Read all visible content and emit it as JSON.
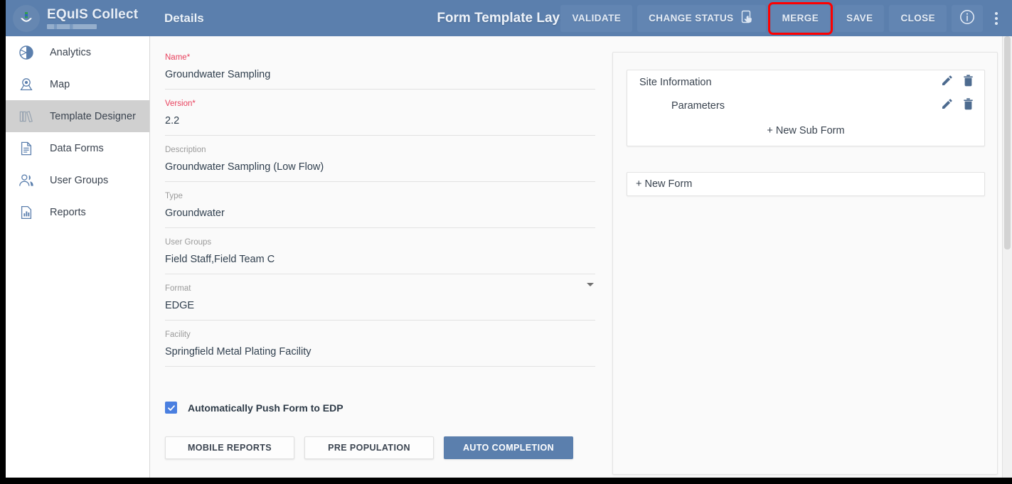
{
  "header": {
    "brand": "EQuIS Collect",
    "section": "Details",
    "title": "Form Template Layout",
    "logo_icon": "equis-anchor-logo-icon",
    "actions": [
      {
        "label": "VALIDATE",
        "name": "validate-button",
        "icon": null,
        "highlight": false
      },
      {
        "label": "CHANGE STATUS",
        "name": "change-status-button",
        "icon": "tap-device-icon",
        "highlight": false
      },
      {
        "label": "MERGE",
        "name": "merge-button",
        "icon": null,
        "highlight": true
      },
      {
        "label": "SAVE",
        "name": "save-button",
        "icon": null,
        "highlight": false
      },
      {
        "label": "CLOSE",
        "name": "close-button",
        "icon": null,
        "highlight": false
      }
    ],
    "info_icon": "info-circle-icon",
    "overflow_icon": "kebab-menu-icon",
    "highlight_color": "#ff0000",
    "bar_color": "#5b7fad"
  },
  "sidebar": {
    "items": [
      {
        "label": "Analytics",
        "icon": "pie-chart-icon",
        "active": false
      },
      {
        "label": "Map",
        "icon": "map-pin-icon",
        "active": false
      },
      {
        "label": "Template Designer",
        "icon": "books-icon",
        "active": true
      },
      {
        "label": "Data Forms",
        "icon": "document-icon",
        "active": false
      },
      {
        "label": "User Groups",
        "icon": "users-icon",
        "active": false
      },
      {
        "label": "Reports",
        "icon": "bar-chart-document-icon",
        "active": false
      }
    ]
  },
  "details_form": {
    "fields": [
      {
        "label": "Name",
        "required": true,
        "value": "Groundwater Sampling",
        "type": "text",
        "name": "name-field"
      },
      {
        "label": "Version",
        "required": true,
        "value": "2.2",
        "type": "text",
        "name": "version-field"
      },
      {
        "label": "Description",
        "required": false,
        "value": "Groundwater Sampling (Low Flow)",
        "type": "text",
        "name": "description-field"
      },
      {
        "label": "Type",
        "required": false,
        "value": "Groundwater",
        "type": "text",
        "name": "type-field"
      },
      {
        "label": "User Groups",
        "required": false,
        "value": "Field Staff,Field Team C",
        "type": "text",
        "name": "user-groups-field"
      },
      {
        "label": "Format",
        "required": false,
        "value": "EDGE",
        "type": "select",
        "name": "format-select"
      },
      {
        "label": "Facility",
        "required": false,
        "value": "Springfield Metal Plating Facility",
        "type": "text",
        "name": "facility-field"
      }
    ],
    "checkbox": {
      "label": "Automatically Push Form to EDP",
      "checked": true
    },
    "buttons": [
      {
        "label": "MOBILE REPORTS",
        "name": "mobile-reports-button",
        "primary": false
      },
      {
        "label": "PRE POPULATION",
        "name": "pre-population-button",
        "primary": false
      },
      {
        "label": "AUTO COMPLETION",
        "name": "auto-completion-button",
        "primary": true
      }
    ],
    "required_marker": "*"
  },
  "form_tree": {
    "forms": [
      {
        "name": "Site Information",
        "edit_icon": "pencil-icon",
        "delete_icon": "trash-icon",
        "subforms": [
          {
            "name": "Parameters",
            "edit_icon": "pencil-icon",
            "delete_icon": "trash-icon"
          }
        ],
        "add_subform_label": "+ New Sub Form"
      }
    ],
    "add_form_label": "+ New Form"
  }
}
